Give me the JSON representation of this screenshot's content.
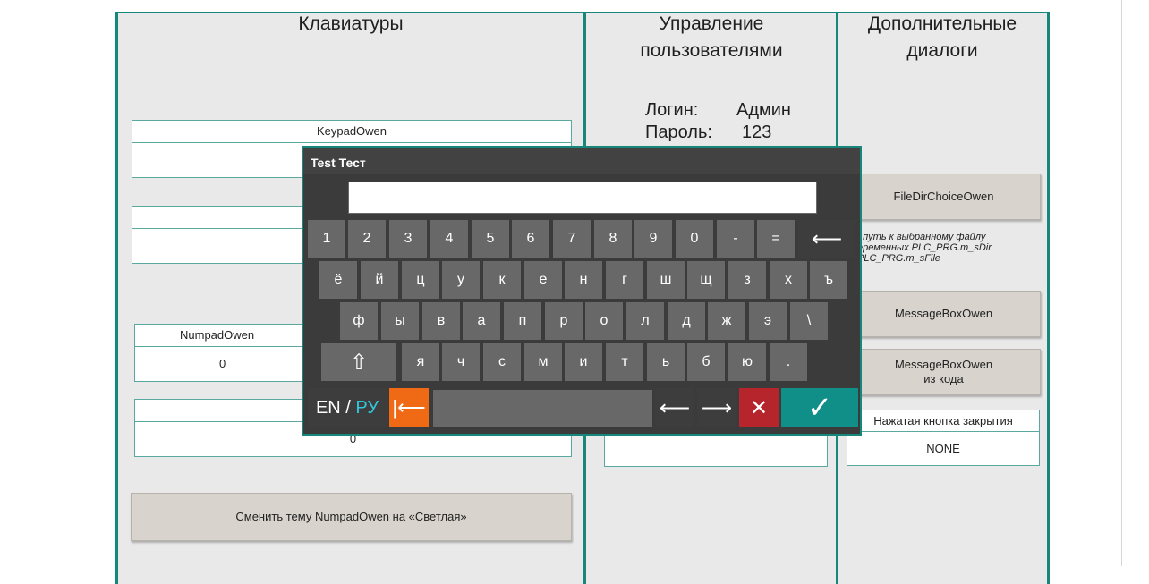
{
  "columns": {
    "keyboards": {
      "title": "Клавиатуры",
      "fields": [
        {
          "header": "KeypadOwen",
          "value": ""
        },
        {
          "header": "",
          "value": ""
        },
        {
          "header": "NumpadOwen",
          "value": "0"
        },
        {
          "header": "",
          "value": "0"
        }
      ],
      "theme_button": "Сменить тему NumpadOwen на «Светлая»"
    },
    "users": {
      "title_line1": "Управление",
      "title_line2": "пользователями",
      "login_label": "Логин:",
      "login_value": "Админ",
      "password_label": "Пароль:",
      "password_value": "123"
    },
    "dialogs": {
      "title_line1": "Дополнительные",
      "title_line2": "диалоги",
      "filedir_button": "FileDirChoiceOwen",
      "path_note_1": ": путь к выбранному файлу",
      "path_note_2": "еременных PLC_PRG.m_sDir",
      "path_note_3": "PLC_PRG.m_sFile",
      "msgbox_button": "MessageBoxOwen",
      "msgbox_code_line1": "MessageBoxOwen",
      "msgbox_code_line2": "из кода",
      "close_header": "Нажатая кнопка закрытия",
      "close_value": "NONE"
    }
  },
  "keyboard_dialog": {
    "title": "Test Тест",
    "input_value": "",
    "row1": [
      "1",
      "2",
      "3",
      "4",
      "5",
      "6",
      "7",
      "8",
      "9",
      "0",
      "-",
      "=",
      "⟵"
    ],
    "row2": [
      "ё",
      "й",
      "ц",
      "у",
      "к",
      "е",
      "н",
      "г",
      "ш",
      "щ",
      "з",
      "х",
      "ъ"
    ],
    "row3": [
      "ф",
      "ы",
      "в",
      "а",
      "п",
      "р",
      "о",
      "л",
      "д",
      "ж",
      "э",
      "\\"
    ],
    "row4": [
      "⇧",
      "я",
      "ч",
      "с",
      "м",
      "и",
      "т",
      "ь",
      "б",
      "ю",
      "."
    ],
    "lang_en": "EN",
    "lang_sep": " / ",
    "lang_ru": "РУ",
    "home_key": "|⟵",
    "left_key": "⟵",
    "right_key": "⟶",
    "cancel_key": "✕",
    "ok_key": "✓"
  },
  "colors": {
    "accent_teal": "#17877c",
    "cancel_red": "#b5252b",
    "home_orange": "#f06a16",
    "ok_teal": "#0f8f88",
    "lang_ru": "#34c6dc"
  }
}
